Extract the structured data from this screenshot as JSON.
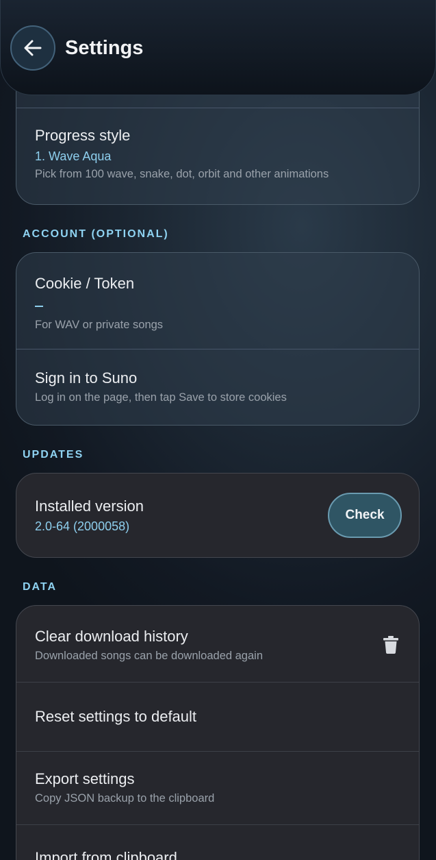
{
  "header": {
    "title": "Settings",
    "back_icon": "arrow-left-icon"
  },
  "progress_card": {
    "title": "Progress style",
    "value": "1. Wave Aqua",
    "subtitle": "Pick from 100 wave, snake, dot, orbit and other animations"
  },
  "account": {
    "section_label": "ACCOUNT (OPTIONAL)",
    "cookie": {
      "title": "Cookie / Token",
      "value": "–",
      "subtitle": "For WAV or private songs"
    },
    "signin": {
      "title": "Sign in to Suno",
      "subtitle": "Log in on the page, then tap Save to store cookies"
    }
  },
  "updates": {
    "section_label": "UPDATES",
    "title": "Installed version",
    "value": "2.0-64 (2000058)",
    "check_label": "Check"
  },
  "data": {
    "section_label": "DATA",
    "clear_history": {
      "title": "Clear download history",
      "subtitle": "Downloaded songs can be downloaded again",
      "icon": "trash-icon"
    },
    "reset": {
      "title": "Reset settings to default"
    },
    "export": {
      "title": "Export settings",
      "subtitle": "Copy JSON backup to the clipboard"
    },
    "import": {
      "title": "Import from clipboard"
    }
  },
  "colors": {
    "accent": "#8fd3f2",
    "value_text": "#8ecfee",
    "check_button": "#2f5564"
  }
}
